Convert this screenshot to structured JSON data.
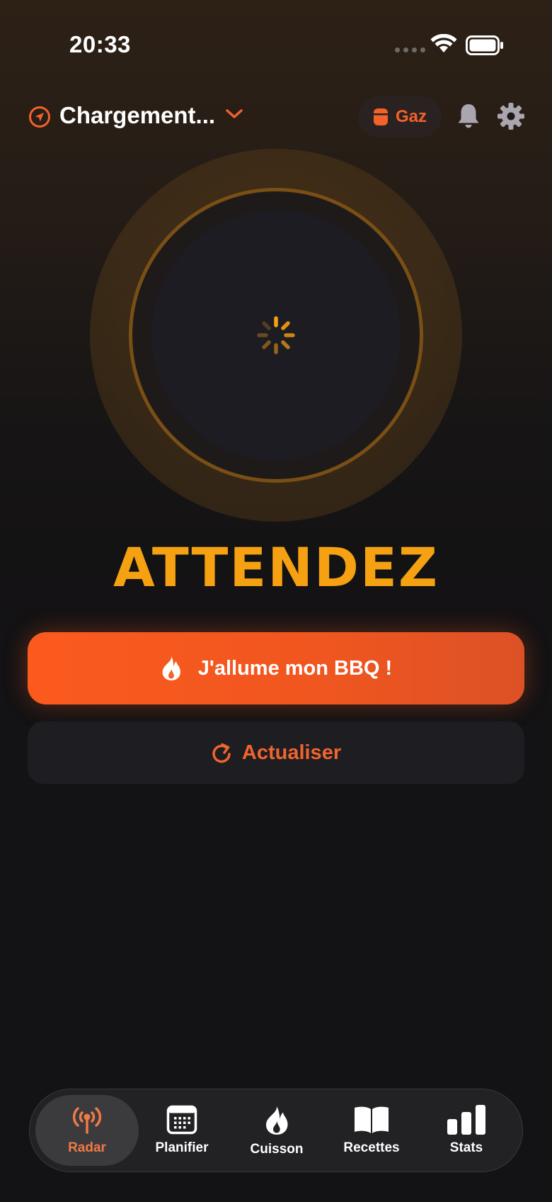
{
  "status_bar": {
    "time": "20:33"
  },
  "header": {
    "location_title": "Chargement...",
    "fuel_chip_label": "Gaz"
  },
  "radar": {
    "state": "loading"
  },
  "status_word": "ATTENDEZ",
  "actions": {
    "primary_label": "J'allume mon BBQ !",
    "secondary_label": "Actualiser"
  },
  "tab_bar": {
    "active": "radar",
    "tabs": [
      {
        "id": "radar",
        "label": "Radar",
        "icon": "radar-icon"
      },
      {
        "id": "planifier",
        "label": "Planifier",
        "icon": "calendar-icon"
      },
      {
        "id": "cuisson",
        "label": "Cuisson",
        "icon": "flame-icon"
      },
      {
        "id": "recettes",
        "label": "Recettes",
        "icon": "book-icon"
      },
      {
        "id": "stats",
        "label": "Stats",
        "icon": "bar-chart-icon"
      }
    ]
  },
  "colors": {
    "accent_orange": "#f2622a",
    "status_amber": "#f5a112",
    "background": "#131214"
  }
}
